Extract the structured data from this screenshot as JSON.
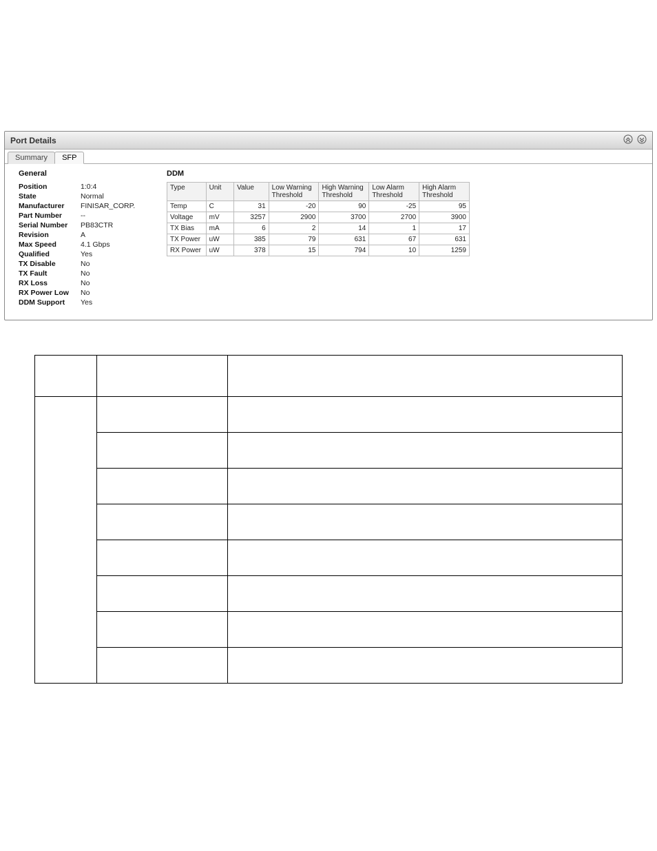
{
  "panel": {
    "title": "Port Details",
    "tabs": [
      {
        "label": "Summary",
        "active": false
      },
      {
        "label": "SFP",
        "active": true
      }
    ],
    "icons": {
      "collapse": "collapse-icon",
      "expand": "expand-icon"
    }
  },
  "general": {
    "heading": "General",
    "rows": [
      {
        "label": "Position",
        "value": "1:0:4"
      },
      {
        "label": "State",
        "value": "Normal"
      },
      {
        "label": "Manufacturer",
        "value": "FINISAR_CORP."
      },
      {
        "label": "Part Number",
        "value": "--"
      },
      {
        "label": "Serial Number",
        "value": "PB83CTR"
      },
      {
        "label": "Revision",
        "value": "A"
      },
      {
        "label": "Max Speed",
        "value": "4.1 Gbps"
      },
      {
        "label": "Qualified",
        "value": "Yes"
      },
      {
        "label": "TX Disable",
        "value": "No"
      },
      {
        "label": "TX Fault",
        "value": "No"
      },
      {
        "label": "RX Loss",
        "value": "No"
      },
      {
        "label": "RX Power Low",
        "value": "No"
      },
      {
        "label": "DDM Support",
        "value": "Yes"
      }
    ]
  },
  "ddm": {
    "heading": "DDM",
    "headers": [
      "Type",
      "Unit",
      "Value",
      "Low Warning Threshold",
      "High Warning Threshold",
      "Low Alarm Threshold",
      "High Alarm Threshold"
    ],
    "rows": [
      {
        "type": "Temp",
        "unit": "C",
        "value": "31",
        "low_warn": "-20",
        "high_warn": "90",
        "low_alarm": "-25",
        "high_alarm": "95"
      },
      {
        "type": "Voltage",
        "unit": "mV",
        "value": "3257",
        "low_warn": "2900",
        "high_warn": "3700",
        "low_alarm": "2700",
        "high_alarm": "3900"
      },
      {
        "type": "TX Bias",
        "unit": "mA",
        "value": "6",
        "low_warn": "2",
        "high_warn": "14",
        "low_alarm": "1",
        "high_alarm": "17"
      },
      {
        "type": "TX Power",
        "unit": "uW",
        "value": "385",
        "low_warn": "79",
        "high_warn": "631",
        "low_alarm": "67",
        "high_alarm": "631"
      },
      {
        "type": "RX Power",
        "unit": "uW",
        "value": "378",
        "low_warn": "15",
        "high_warn": "794",
        "low_alarm": "10",
        "high_alarm": "1259"
      }
    ]
  },
  "doc_table": {
    "header": [
      "",
      "",
      ""
    ],
    "rows": [
      [
        "",
        "",
        ""
      ],
      [
        "",
        "",
        ""
      ],
      [
        "",
        "",
        ""
      ],
      [
        "",
        "",
        ""
      ],
      [
        "",
        "",
        ""
      ],
      [
        "",
        "",
        ""
      ],
      [
        "",
        "",
        ""
      ],
      [
        "",
        "",
        ""
      ]
    ]
  }
}
